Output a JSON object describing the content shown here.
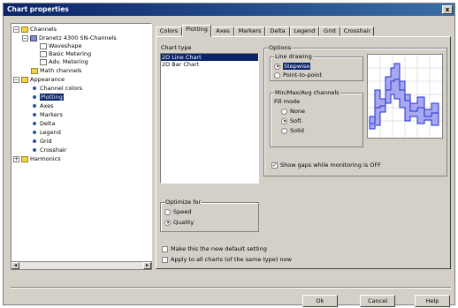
{
  "window": {
    "title": "Chart properties",
    "close_label": "x"
  },
  "tree": {
    "channels": "Channels",
    "device": "Dranetz 4300 SN-Channels",
    "waveshape": "Waveshape",
    "basic_metering": "Basic Metering",
    "adv_metering": "Adv. Metering",
    "math_channels": "Math channels",
    "appearance": "Appearance",
    "channel_colors": "Channel colors",
    "plotting": "Plotting",
    "axes": "Axes",
    "markers": "Markers",
    "delta": "Delta",
    "legend": "Legend",
    "grid": "Grid",
    "crosshair": "Crosshair",
    "harmonics": "Harmonics"
  },
  "tabs": [
    "Colors",
    "Plotting",
    "Axes",
    "Markers",
    "Delta",
    "Legend",
    "Grid",
    "Crosshair"
  ],
  "panel": {
    "chart_type_label": "Chart type",
    "chart_types": [
      "2D Line Chart",
      "2D Bar Chart"
    ],
    "options_label": "Options",
    "line_drawing_label": "Line drawing",
    "stepwise": "Stepwise",
    "point_to_point": "Point-to-point",
    "minmax_label": "Min/Max/Avg channels",
    "fill_mode_label": "Fill mode",
    "fill_none": "None",
    "fill_soft": "Soft",
    "fill_solid": "Solid",
    "show_gaps": "Show gaps while monitoring is OFF",
    "optimize_label": "Optimize for",
    "speed": "Speed",
    "quality": "Quality",
    "default_setting": "Make this the new default setting",
    "apply_all": "Apply to all charts (of the same type) now"
  },
  "buttons": {
    "ok": "Ok",
    "cancel": "Cancel",
    "help": "Help"
  },
  "colors": {
    "title_bar": "#0a246a",
    "selection": "#0a246a",
    "preview_line": "#2030d0",
    "preview_fill": "#a8a8f0"
  }
}
